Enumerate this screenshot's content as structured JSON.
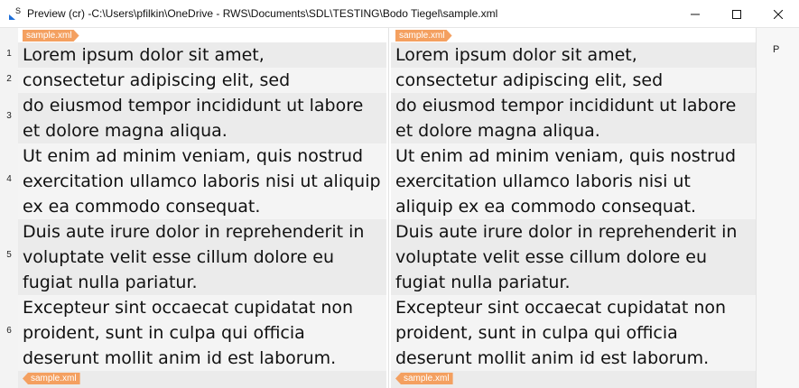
{
  "window": {
    "title": "Preview (cr) -C:\\Users\\pfilkin\\OneDrive - RWS\\Documents\\SDL\\TESTING\\Bodo Tiegel\\sample.xml",
    "app_icon_letter": "S",
    "app_icon": "app-logo-icon",
    "minimize_icon": "minimize-icon",
    "maximize_icon": "maximize-icon",
    "close_icon": "close-icon"
  },
  "side_panel": {
    "label": "P"
  },
  "tags": {
    "open": "sample.xml",
    "close": "sample.xml"
  },
  "segments": [
    {
      "num": "1",
      "source": "Lorem ipsum dolor sit amet,",
      "target": "Lorem ipsum dolor sit amet,"
    },
    {
      "num": "2",
      "source": "consectetur adipiscing elit, sed",
      "target": "consectetur adipiscing elit, sed"
    },
    {
      "num": "3",
      "source": "do eiusmod tempor incididunt ut labore et dolore magna aliqua.",
      "target": "do eiusmod tempor incididunt ut labore et dolore magna aliqua."
    },
    {
      "num": "4",
      "source": "Ut enim ad minim veniam, quis nostrud exercitation ullamco laboris nisi ut aliquip ex ea commodo consequat.",
      "target": "Ut enim ad minim veniam, quis nostrud exercitation ullamco laboris nisi ut aliquip ex ea commodo consequat."
    },
    {
      "num": "5",
      "source": "Duis aute irure dolor in reprehenderit in voluptate velit esse cillum dolore eu fugiat nulla pariatur.",
      "target": "Duis aute irure dolor in reprehenderit in voluptate velit esse cillum dolore eu fugiat nulla pariatur."
    },
    {
      "num": "6",
      "source": "Excepteur sint occaecat cupidatat non proident, sunt in culpa qui officia deserunt mollit anim id est laborum.",
      "target": "Excepteur sint occaecat cupidatat non proident, sunt in culpa qui officia deserunt mollit anim id est laborum."
    }
  ]
}
